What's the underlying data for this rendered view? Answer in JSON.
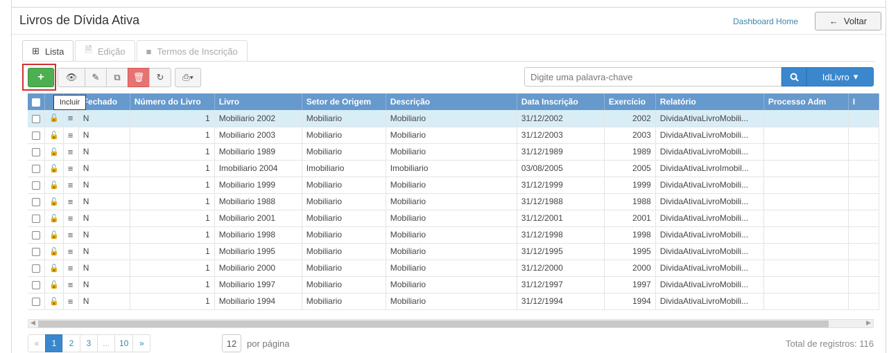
{
  "header": {
    "title": "Livros de Dívida Ativa",
    "dashboard_link": "Dashboard Home",
    "back_label": "Voltar"
  },
  "tabs": [
    {
      "label": "Lista",
      "icon": "table-icon",
      "active": true
    },
    {
      "label": "Edição",
      "icon": "document-icon",
      "active": false
    },
    {
      "label": "Termos de Inscrição",
      "icon": "square-icon",
      "active": false
    }
  ],
  "toolbar": {
    "add_icon": "+",
    "view_icon": "👁",
    "edit_icon": "✎",
    "copy_icon": "⧉",
    "delete_icon": "🗑",
    "refresh_icon": "↻",
    "print_icon": "⎙▾",
    "tooltip": "Incluir"
  },
  "search": {
    "placeholder": "Digite uma palavra-chave",
    "value": "",
    "field_label": "IdLivro"
  },
  "table": {
    "columns": [
      "",
      "",
      "",
      "Fechado",
      "Número do Livro",
      "Livro",
      "Setor de Origem",
      "Descrição",
      "Data Inscrição",
      "Exercício",
      "Relatório",
      "Processo Adm",
      "I"
    ],
    "rows": [
      [
        "N",
        "1",
        "Mobiliario 2002",
        "Mobiliario",
        "Mobiliario",
        "31/12/2002",
        "2002",
        "DividaAtivaLivroMobili..."
      ],
      [
        "N",
        "1",
        "Mobiliario 2003",
        "Mobiliario",
        "Mobiliario",
        "31/12/2003",
        "2003",
        "DividaAtivaLivroMobili..."
      ],
      [
        "N",
        "1",
        "Mobiliario 1989",
        "Mobiliario",
        "Mobiliario",
        "31/12/1989",
        "1989",
        "DividaAtivaLivroMobili..."
      ],
      [
        "N",
        "1",
        "Imobiliario 2004",
        "Imobiliario",
        "Imobiliario",
        "03/08/2005",
        "2005",
        "DividaAtivaLivroImobil..."
      ],
      [
        "N",
        "1",
        "Mobiliario 1999",
        "Mobiliario",
        "Mobiliario",
        "31/12/1999",
        "1999",
        "DividaAtivaLivroMobili..."
      ],
      [
        "N",
        "1",
        "Mobiliario 1988",
        "Mobiliario",
        "Mobiliario",
        "31/12/1988",
        "1988",
        "DividaAtivaLivroMobili..."
      ],
      [
        "N",
        "1",
        "Mobiliario 2001",
        "Mobiliario",
        "Mobiliario",
        "31/12/2001",
        "2001",
        "DividaAtivaLivroMobili..."
      ],
      [
        "N",
        "1",
        "Mobiliario 1998",
        "Mobiliario",
        "Mobiliario",
        "31/12/1998",
        "1998",
        "DividaAtivaLivroMobili..."
      ],
      [
        "N",
        "1",
        "Mobiliario 1995",
        "Mobiliario",
        "Mobiliario",
        "31/12/1995",
        "1995",
        "DividaAtivaLivroMobili..."
      ],
      [
        "N",
        "1",
        "Mobiliario 2000",
        "Mobiliario",
        "Mobiliario",
        "31/12/2000",
        "2000",
        "DividaAtivaLivroMobili..."
      ],
      [
        "N",
        "1",
        "Mobiliario 1997",
        "Mobiliario",
        "Mobiliario",
        "31/12/1997",
        "1997",
        "DividaAtivaLivroMobili..."
      ],
      [
        "N",
        "1",
        "Mobiliario 1994",
        "Mobiliario",
        "Mobiliario",
        "31/12/1994",
        "1994",
        "DividaAtivaLivroMobili..."
      ]
    ],
    "lock_icon": "🔓",
    "menu_icon": "≡"
  },
  "pagination": {
    "first": "«",
    "pages": [
      "1",
      "2",
      "3",
      "...",
      "10"
    ],
    "next": "»",
    "per_page_value": "12",
    "per_page_label": "por página",
    "total": "Total de registros: 116"
  },
  "colors": {
    "header_bg": "#6699cc",
    "accent": "#3a87cd",
    "add_green": "#4caf50",
    "delete_red": "#e57373",
    "selected_row": "#d9edf7",
    "highlight": "#d32f2f"
  }
}
